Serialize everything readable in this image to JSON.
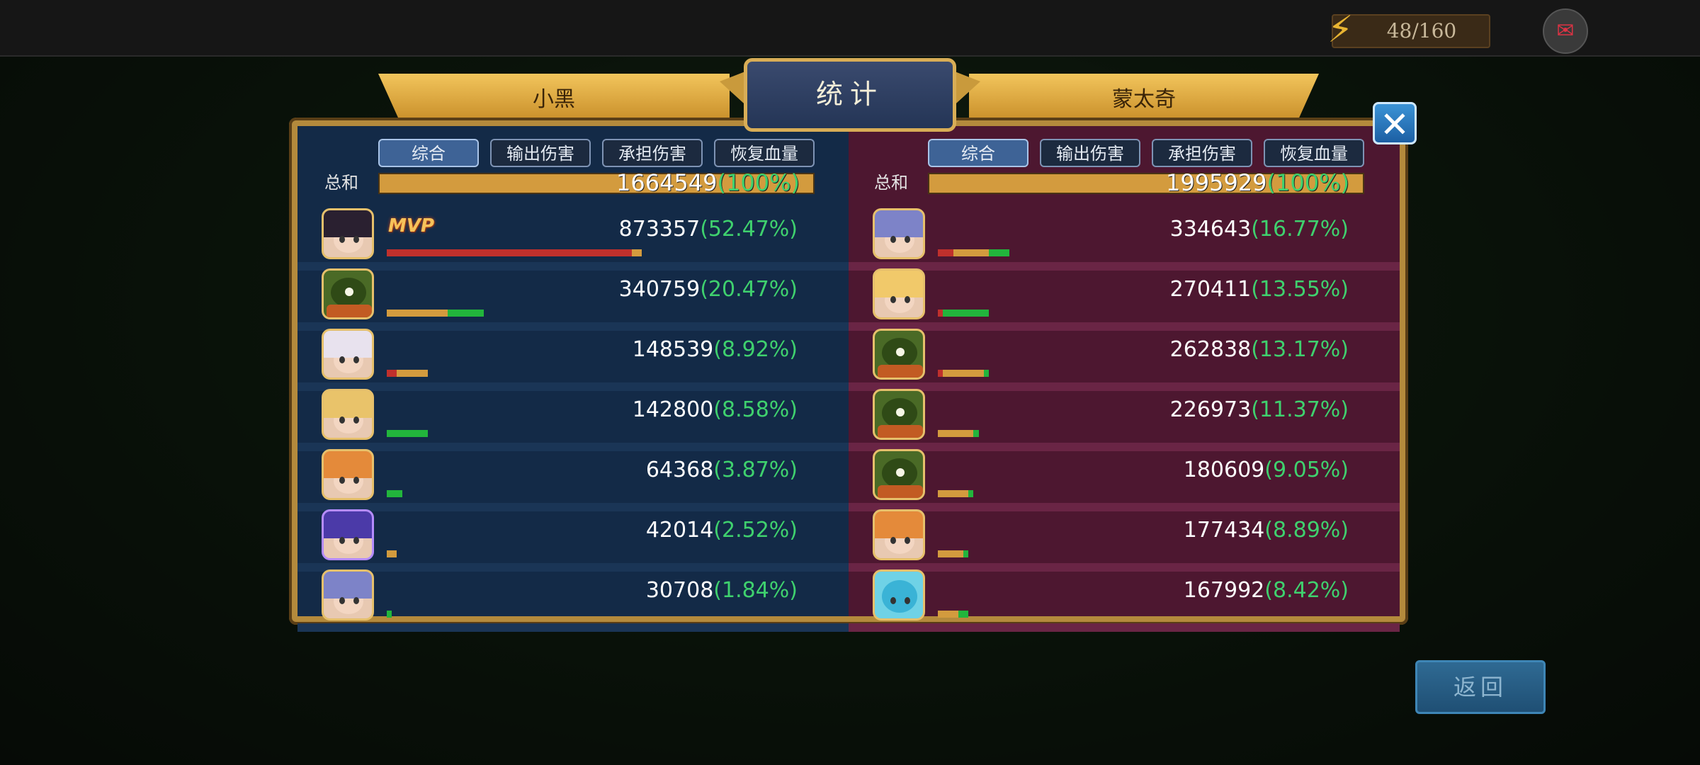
{
  "energy": {
    "value": "48/160",
    "icon": "lightning-icon",
    "color": "#e8b432"
  },
  "chat_icon": "chat-icon",
  "title": "统计",
  "close_icon": "close-icon",
  "back_label": "返回",
  "colors": {
    "ally_panel": "#132a47",
    "enemy_panel": "#4d1730",
    "damage_bar": "#d39b3e",
    "taken_bar": "#c0302c",
    "heal_bar": "#22b53c",
    "percent_text": "#3fd16e",
    "gold": "#c99a3c"
  },
  "teams": [
    {
      "name": "小黑",
      "filters": [
        "综合",
        "输出伤害",
        "承担伤害",
        "恢复血量"
      ],
      "active_filter": "综合",
      "total_label": "总和",
      "total_value": "1664549",
      "total_pct": "(100%)",
      "rows": [
        {
          "avatar": "hero-dark-hair",
          "value": "873357",
          "pct": "(52.47%)",
          "mvp": "MVP",
          "share": {
            "taken": 0.48,
            "damage": 0.02,
            "heal": 0.0
          }
        },
        {
          "avatar": "hero-tree",
          "value": "340759",
          "pct": "(20.47%)",
          "share": {
            "taken": 0.0,
            "damage": 0.12,
            "heal": 0.07
          }
        },
        {
          "avatar": "hero-white-hair",
          "value": "148539",
          "pct": "(8.92%)",
          "share": {
            "taken": 0.02,
            "damage": 0.06,
            "heal": 0.0
          }
        },
        {
          "avatar": "hero-blonde",
          "value": "142800",
          "pct": "(8.58%)",
          "share": {
            "taken": 0.0,
            "damage": 0.0,
            "heal": 0.08
          }
        },
        {
          "avatar": "hero-orange-hair",
          "value": "64368",
          "pct": "(3.87%)",
          "share": {
            "taken": 0.0,
            "damage": 0.0,
            "heal": 0.03
          }
        },
        {
          "avatar": "hero-purple-beast",
          "value": "42014",
          "pct": "(2.52%)",
          "share": {
            "taken": 0.0,
            "damage": 0.02,
            "heal": 0.0
          }
        },
        {
          "avatar": "hero-silver-hair",
          "value": "30708",
          "pct": "(1.84%)",
          "share": {
            "taken": 0.0,
            "damage": 0.0,
            "heal": 0.01
          }
        }
      ]
    },
    {
      "name": "蒙太奇",
      "filters": [
        "综合",
        "输出伤害",
        "承担伤害",
        "恢复血量"
      ],
      "active_filter": "综合",
      "total_label": "总和",
      "total_value": "1995929",
      "total_pct": "(100%)",
      "rows": [
        {
          "avatar": "hero-silver-hair",
          "value": "334643",
          "pct": "(16.77%)",
          "share": {
            "taken": 0.03,
            "damage": 0.07,
            "heal": 0.04
          }
        },
        {
          "avatar": "hero-blonde-crown",
          "value": "270411",
          "pct": "(13.55%)",
          "share": {
            "taken": 0.01,
            "damage": 0.0,
            "heal": 0.09
          }
        },
        {
          "avatar": "hero-tree",
          "value": "262838",
          "pct": "(13.17%)",
          "share": {
            "taken": 0.01,
            "damage": 0.08,
            "heal": 0.01
          }
        },
        {
          "avatar": "hero-tree",
          "value": "226973",
          "pct": "(11.37%)",
          "share": {
            "taken": 0.0,
            "damage": 0.07,
            "heal": 0.01
          }
        },
        {
          "avatar": "hero-tree",
          "value": "180609",
          "pct": "(9.05%)",
          "share": {
            "taken": 0.0,
            "damage": 0.06,
            "heal": 0.01
          }
        },
        {
          "avatar": "hero-orange-hair",
          "value": "177434",
          "pct": "(8.89%)",
          "share": {
            "taken": 0.0,
            "damage": 0.05,
            "heal": 0.01
          }
        },
        {
          "avatar": "hero-spirit",
          "value": "167992",
          "pct": "(8.42%)",
          "share": {
            "taken": 0.0,
            "damage": 0.04,
            "heal": 0.02
          }
        }
      ]
    }
  ]
}
